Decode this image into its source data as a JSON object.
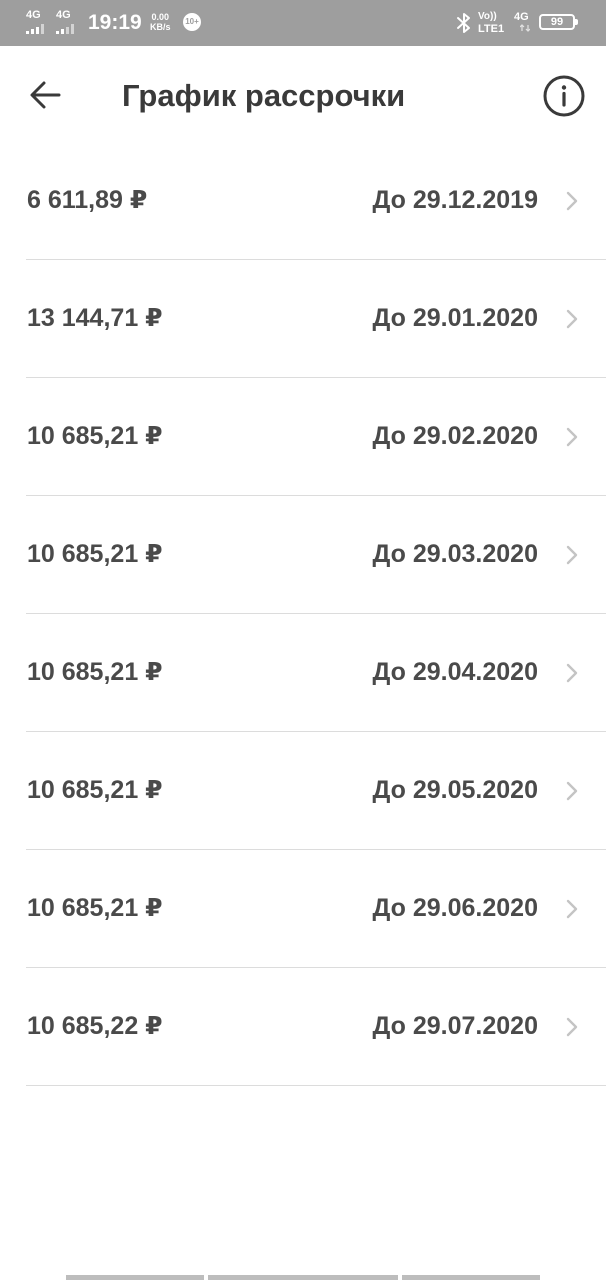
{
  "status_bar": {
    "network_1": "4G",
    "network_2": "4G",
    "time": "19:19",
    "speed_value": "0.00",
    "speed_unit": "KB/s",
    "notification_badge": "10+",
    "volte_label": "Vo))",
    "lte_label": "LTE1",
    "network_3": "4G",
    "battery_level": "99"
  },
  "app_bar": {
    "title": "График рассрочки",
    "back_icon": "arrow-left-icon",
    "info_icon": "info-circle-icon"
  },
  "schedule": [
    {
      "amount": "6 611,89 ₽",
      "due": "До 29.12.2019"
    },
    {
      "amount": "13 144,71 ₽",
      "due": "До 29.01.2020"
    },
    {
      "amount": "10 685,21 ₽",
      "due": "До 29.02.2020"
    },
    {
      "amount": "10 685,21 ₽",
      "due": "До 29.03.2020"
    },
    {
      "amount": "10 685,21 ₽",
      "due": "До 29.04.2020"
    },
    {
      "amount": "10 685,21 ₽",
      "due": "До 29.05.2020"
    },
    {
      "amount": "10 685,21 ₽",
      "due": "До 29.06.2020"
    },
    {
      "amount": "10 685,22 ₽",
      "due": "До 29.07.2020"
    }
  ],
  "colors": {
    "status_bar_bg": "#9e9e9e",
    "text_primary": "#3a3a3a",
    "text_item": "#4a4a4a",
    "divider": "#dcdcdc",
    "chevron": "#c4c4c4"
  }
}
